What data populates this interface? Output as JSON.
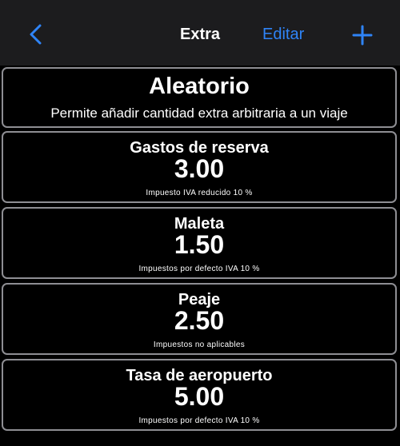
{
  "navbar": {
    "back_icon": "chevron-left-icon",
    "title": "Extra",
    "edit_label": "Editar",
    "add_icon": "plus-icon",
    "accent_color": "#2f84f7"
  },
  "header_card": {
    "title": "Aleatorio",
    "subtitle": "Permite añadir cantidad extra arbitraria a un viaje"
  },
  "items": [
    {
      "name": "Gastos de reserva",
      "price": "3.00",
      "tax": "Impuesto IVA reducido 10 %"
    },
    {
      "name": "Maleta",
      "price": "1.50",
      "tax": "Impuestos por defecto IVA 10 %"
    },
    {
      "name": "Peaje",
      "price": "2.50",
      "tax": "Impuestos no aplicables"
    },
    {
      "name": "Tasa de aeropuerto",
      "price": "5.00",
      "tax": "Impuestos por defecto IVA 10 %"
    }
  ]
}
